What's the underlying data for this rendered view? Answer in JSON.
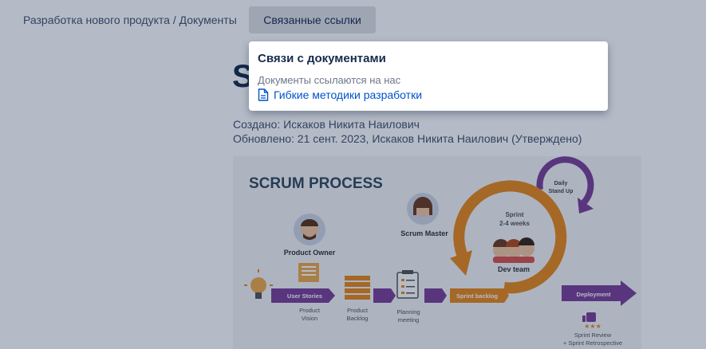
{
  "breadcrumb": {
    "project": "Разработка нового продукта",
    "separator": "/",
    "section": "Документы"
  },
  "linked_button_label": "Связанные ссылки",
  "page_title_visible": "S",
  "meta": {
    "created": "Создано: Искаков Никита Наилович",
    "updated": "Обновлено: 21 сент. 2023, Искаков Никита Наилович  (Утверждено)"
  },
  "popup": {
    "title": "Связи с документами",
    "subtitle": "Документы ссылаются на нас",
    "link_label": "Гибкие методики разработки",
    "link_icon": "document-icon"
  },
  "diagram": {
    "title": "SCRUM PROCESS",
    "daily_standup": [
      "Daily",
      "Stand Up"
    ],
    "sprint": [
      "Sprint",
      "2-4 weeks"
    ],
    "scrum_master": "Scrum Master",
    "product_owner": "Product Owner",
    "dev_team": "Dev team",
    "user_stories": "User Stories",
    "sprint_backlog": "Sprint backlog",
    "deployment": "Deployment",
    "product_vision": [
      "Product",
      "Vision"
    ],
    "product_backlog": [
      "Product",
      "Backlog"
    ],
    "planning_meeting": [
      "Planning",
      "meeting"
    ],
    "sprint_review": [
      "Sprint Review",
      "+ Sprint Retrospective"
    ]
  },
  "colors": {
    "accent": "#0052cc",
    "orange": "#e8891b",
    "purple": "#7b3f98",
    "overlay": "rgba(9,30,66,0.30)"
  }
}
